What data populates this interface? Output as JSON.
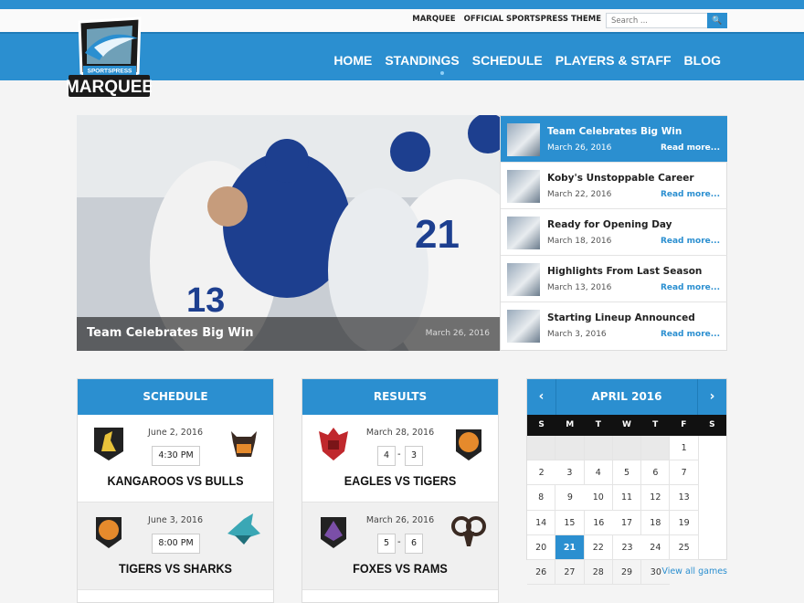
{
  "top_links": [
    "MARQUEE",
    "OFFICIAL SPORTSPRESS THEME"
  ],
  "search": {
    "placeholder": "Search ...",
    "button": "🔍"
  },
  "logo": {
    "top_text": "SPORTSPRESS",
    "bottom_text": "MARQUEE"
  },
  "nav": [
    "HOME",
    "STANDINGS",
    "SCHEDULE",
    "PLAYERS & STAFF",
    "BLOG"
  ],
  "hero": {
    "title": "Team Celebrates Big Win",
    "date": "March 26, 2016"
  },
  "news": [
    {
      "title": "Team Celebrates Big Win",
      "date": "March 26, 2016",
      "more": "Read more..."
    },
    {
      "title": "Koby's Unstoppable Career",
      "date": "March 22, 2016",
      "more": "Read more..."
    },
    {
      "title": "Ready for Opening Day",
      "date": "March 18, 2016",
      "more": "Read more..."
    },
    {
      "title": "Highlights From Last Season",
      "date": "March 13, 2016",
      "more": "Read more..."
    },
    {
      "title": "Starting Lineup Announced",
      "date": "March 3, 2016",
      "more": "Read more..."
    }
  ],
  "schedule": {
    "title": "SCHEDULE",
    "games": [
      {
        "date": "June 2, 2016",
        "time": "4:30 PM",
        "name": "KANGAROOS VS BULLS"
      },
      {
        "date": "June 3, 2016",
        "time": "8:00 PM",
        "name": "TIGERS VS SHARKS"
      }
    ]
  },
  "results": {
    "title": "RESULTS",
    "games": [
      {
        "date": "March 28, 2016",
        "home": "4",
        "away": "3",
        "name": "EAGLES VS TIGERS"
      },
      {
        "date": "March 26, 2016",
        "home": "5",
        "away": "6",
        "name": "FOXES VS RAMS"
      }
    ]
  },
  "calendar": {
    "prev": "‹",
    "next": "›",
    "month": "APRIL 2016",
    "days": [
      "S",
      "M",
      "T",
      "W",
      "T",
      "F",
      "S"
    ],
    "weeks": [
      [
        "",
        "",
        "",
        "",
        "",
        "1",
        "2"
      ],
      [
        "3",
        "4",
        "5",
        "6",
        "7",
        "8",
        "9"
      ],
      [
        "10",
        "11",
        "12",
        "13",
        "14",
        "15",
        "16"
      ],
      [
        "17",
        "18",
        "19",
        "20",
        "21",
        "22",
        "23"
      ],
      [
        "24",
        "25",
        "26",
        "27",
        "28",
        "29",
        "30"
      ]
    ],
    "today": "21",
    "view_all": "View all games"
  },
  "colors": {
    "accent": "#2b8fd0",
    "dark": "#111111"
  }
}
